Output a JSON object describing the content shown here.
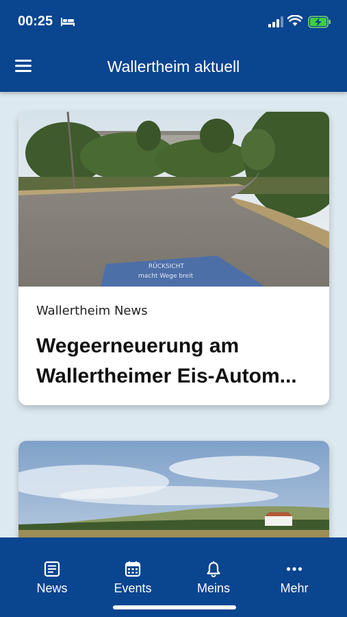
{
  "status_bar": {
    "time": "00:25",
    "icons": [
      "bed-icon",
      "cellular-signal-icon",
      "wifi-icon",
      "battery-charging-icon"
    ]
  },
  "header": {
    "title": "Wallertheim aktuell",
    "menu_icon": "hamburger-menu-icon"
  },
  "feed": [
    {
      "source": "Wallertheim News",
      "headline_line1": "Wegeerneuerung am",
      "headline_line2": "Wallertheimer Eis-Autom...",
      "image_sign_line1": "RÜCKSICHT",
      "image_sign_line2": "macht Wege breit"
    },
    {
      "source": "",
      "headline_line1": "",
      "headline_line2": ""
    }
  ],
  "tabs": [
    {
      "label": "News",
      "icon": "newspaper-icon"
    },
    {
      "label": "Events",
      "icon": "calendar-icon"
    },
    {
      "label": "Meins",
      "icon": "bell-icon"
    },
    {
      "label": "Mehr",
      "icon": "more-dots-icon"
    }
  ],
  "colors": {
    "brand_blue": "#0a4590",
    "background": "#dde9f0",
    "card": "#ffffff"
  }
}
